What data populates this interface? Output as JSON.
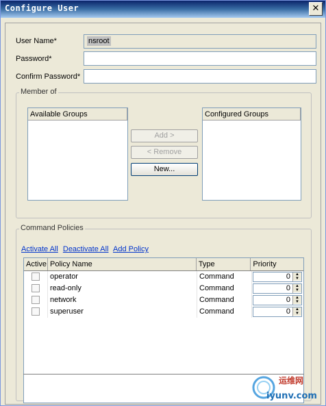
{
  "window": {
    "title": "Configure User",
    "close_glyph": "✕"
  },
  "form": {
    "username_label": "User Name*",
    "username_value": "nsroot",
    "password_label": "Password*",
    "password_value": "",
    "confirm_label": "Confirm Password*",
    "confirm_value": ""
  },
  "member_of": {
    "legend": "Member of",
    "available_header": "Available Groups",
    "configured_header": "Configured Groups",
    "add_label": "Add >",
    "remove_label": "< Remove",
    "new_label": "New..."
  },
  "policies": {
    "legend": "Command Policies",
    "links": [
      "Activate All",
      "Deactivate All",
      "Add Policy"
    ],
    "columns": [
      "Active",
      "Policy Name",
      "Type",
      "Priority"
    ],
    "rows": [
      {
        "active": false,
        "name": "operator",
        "type": "Command",
        "priority": "0"
      },
      {
        "active": false,
        "name": "read-only",
        "type": "Command",
        "priority": "0"
      },
      {
        "active": false,
        "name": "network",
        "type": "Command",
        "priority": "0"
      },
      {
        "active": false,
        "name": "superuser",
        "type": "Command",
        "priority": "0"
      }
    ]
  },
  "watermark": {
    "cn": "运维网",
    "domain": "iyunv.com"
  }
}
